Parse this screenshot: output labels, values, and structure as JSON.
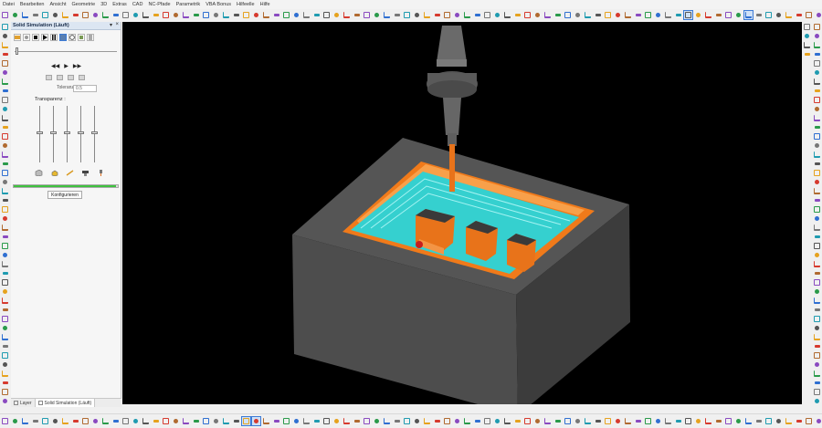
{
  "menu": [
    "Datei",
    "Bearbeiten",
    "Ansicht",
    "Geometrie",
    "3D",
    "Extras",
    "CAD",
    "NC-Pfade",
    "Parametrik",
    "VBA Bonus",
    "Hilfeelle",
    "Hilfe"
  ],
  "panel": {
    "title": "Solid Simulation (Läuft)",
    "close": "×",
    "pin": "▾",
    "tolerance_label": "Toleranz",
    "tolerance_value": "0.5",
    "transparency_label": "Transparenz :",
    "configure_button": "Konfigurieren",
    "progress": 0.98
  },
  "tabs": [
    {
      "label": "Layer"
    },
    {
      "label": "Solid Simulation (Läuft)"
    }
  ],
  "colors": {
    "viewport_bg": "#000000",
    "block": "#4a4a4a",
    "cyan_floor": "#35d0cf",
    "orange": "#f07a1a",
    "tool": "#666666",
    "progress": "#3fc13f"
  },
  "icons": [
    "undo-icon",
    "redo-icon",
    "line-icon",
    "circle-icon",
    "rectangle-icon",
    "zoom-icon",
    "rotate-icon",
    "layer-icon",
    "play-icon",
    "stop-icon",
    "pause-icon"
  ]
}
